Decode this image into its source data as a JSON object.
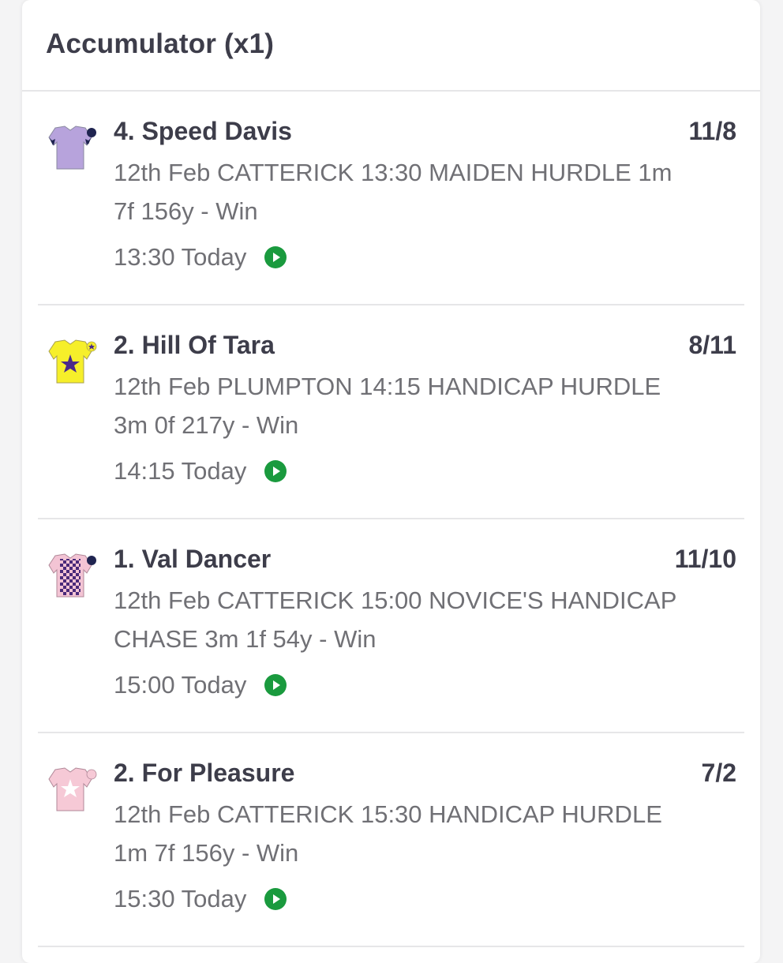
{
  "card": {
    "title": "Accumulator (x1)"
  },
  "legs": [
    {
      "runner": "4. Speed Davis",
      "odds": "11/8",
      "description": "12th Feb CATTERICK 13:30 MAIDEN HURDLE 1m 7f 156y - Win",
      "time": "13:30 Today",
      "silk_icon": "lilac-silk-navy-chevrons-icon",
      "cap_icon": "navy-cap-icon"
    },
    {
      "runner": "2. Hill Of Tara",
      "odds": "8/11",
      "description": "12th Feb PLUMPTON 14:15 HANDICAP HURDLE 3m 0f 217y - Win",
      "time": "14:15 Today",
      "silk_icon": "yellow-silk-purple-star-icon",
      "cap_icon": "yellow-purple-cap-icon"
    },
    {
      "runner": "1. Val Dancer",
      "odds": "11/10",
      "description": "12th Feb CATTERICK 15:00 NOVICE'S HANDICAP CHASE 3m 1f 54y - Win",
      "time": "15:00 Today",
      "silk_icon": "pink-silk-purple-checks-icon",
      "cap_icon": "navy-cap-icon"
    },
    {
      "runner": "2. For Pleasure",
      "odds": "7/2",
      "description": "12th Feb CATTERICK 15:30 HANDICAP HURDLE 1m 7f 156y - Win",
      "time": "15:30 Today",
      "silk_icon": "pink-silk-white-star-icon",
      "cap_icon": "pink-cap-icon"
    }
  ],
  "colors": {
    "text_primary": "#3d3d4a",
    "text_secondary": "#707075",
    "play_green": "#1a9a3e",
    "divider": "#e6e6e8"
  }
}
